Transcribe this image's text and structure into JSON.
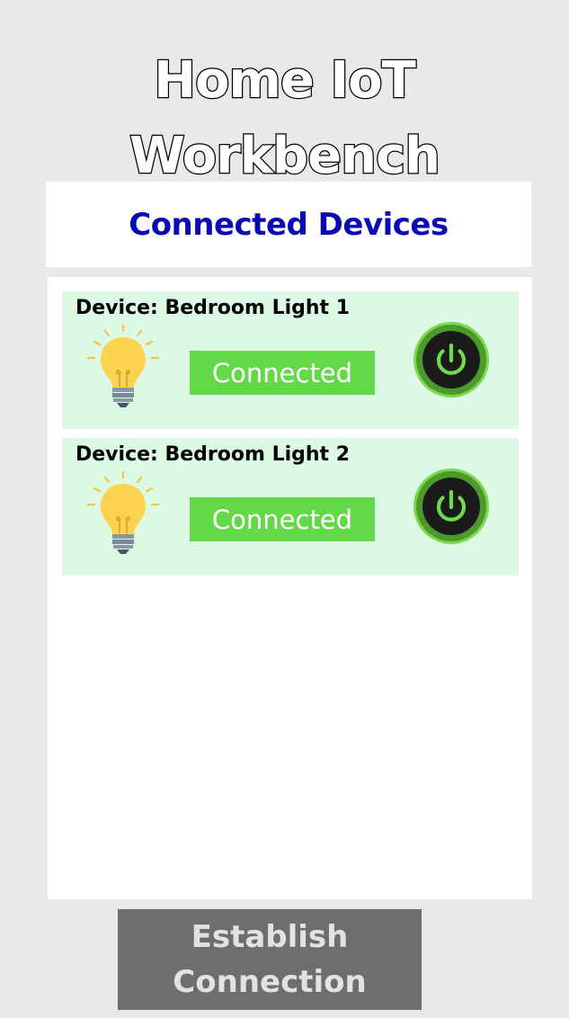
{
  "app": {
    "title_line1": "Home IoT",
    "title_line2": "Workbench"
  },
  "section": {
    "title": "Connected Devices"
  },
  "devices": [
    {
      "name": "Device: Bedroom Light 1",
      "status": "Connected",
      "icon": "light-bulb-icon",
      "power_icon": "power-icon"
    },
    {
      "name": "Device: Bedroom Light 2",
      "status": "Connected",
      "icon": "light-bulb-icon",
      "power_icon": "power-icon"
    }
  ],
  "actions": {
    "connect_line1": "Establish",
    "connect_line2": "Connection"
  },
  "colors": {
    "background": "#e9e9e9",
    "section_title": "#0a0ab4",
    "card_background": "#dcf9e4",
    "status_connected": "#63d947",
    "power_ring": "#7bd84f",
    "button_disabled": "#6e6e6e"
  }
}
